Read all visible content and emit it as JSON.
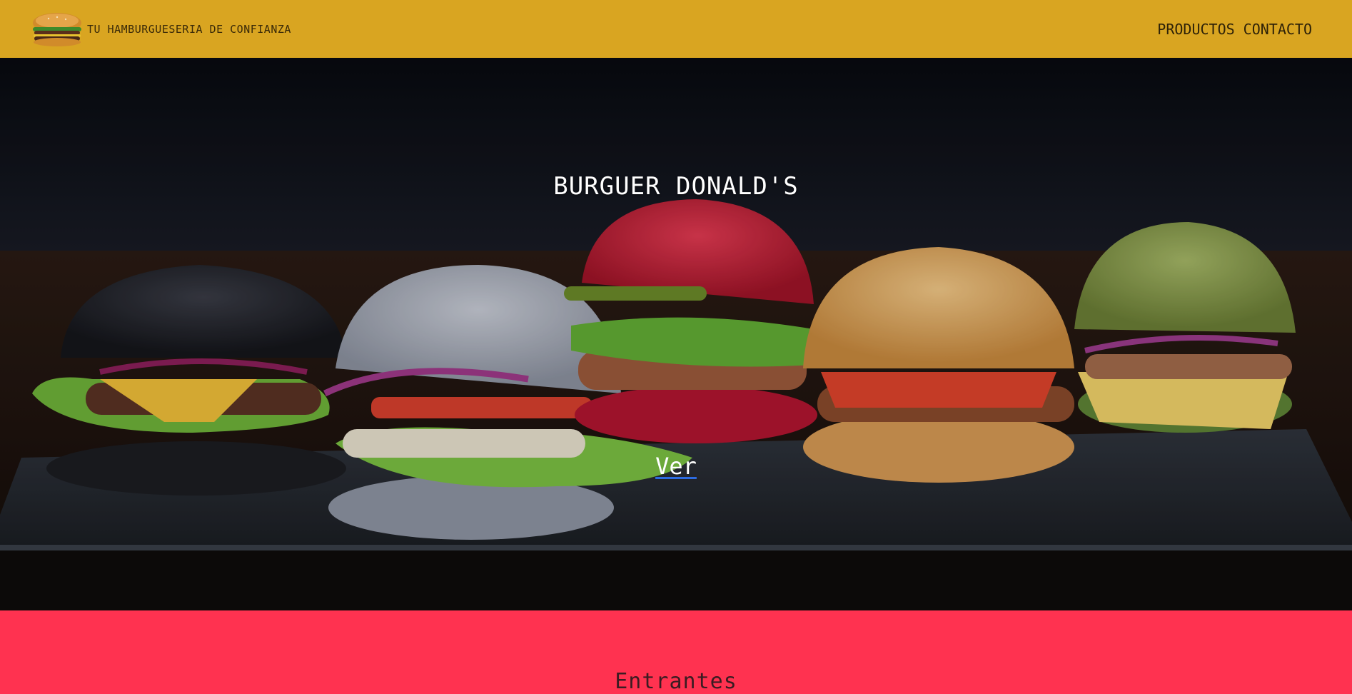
{
  "header": {
    "logo_icon": "burger-logo-icon",
    "brand_text": "TU HAMBURGUESERIA DE CONFIANZA",
    "nav": [
      {
        "label": "PRODUCTOS"
      },
      {
        "label": "CONTACTO"
      }
    ],
    "background_color": "#d9a521"
  },
  "hero": {
    "title": "BURGUER DONALD'S",
    "link_label": "Ver",
    "image": "burgers-on-slate-photo"
  },
  "section": {
    "title": "Entrantes",
    "background_color": "#ff3250"
  }
}
